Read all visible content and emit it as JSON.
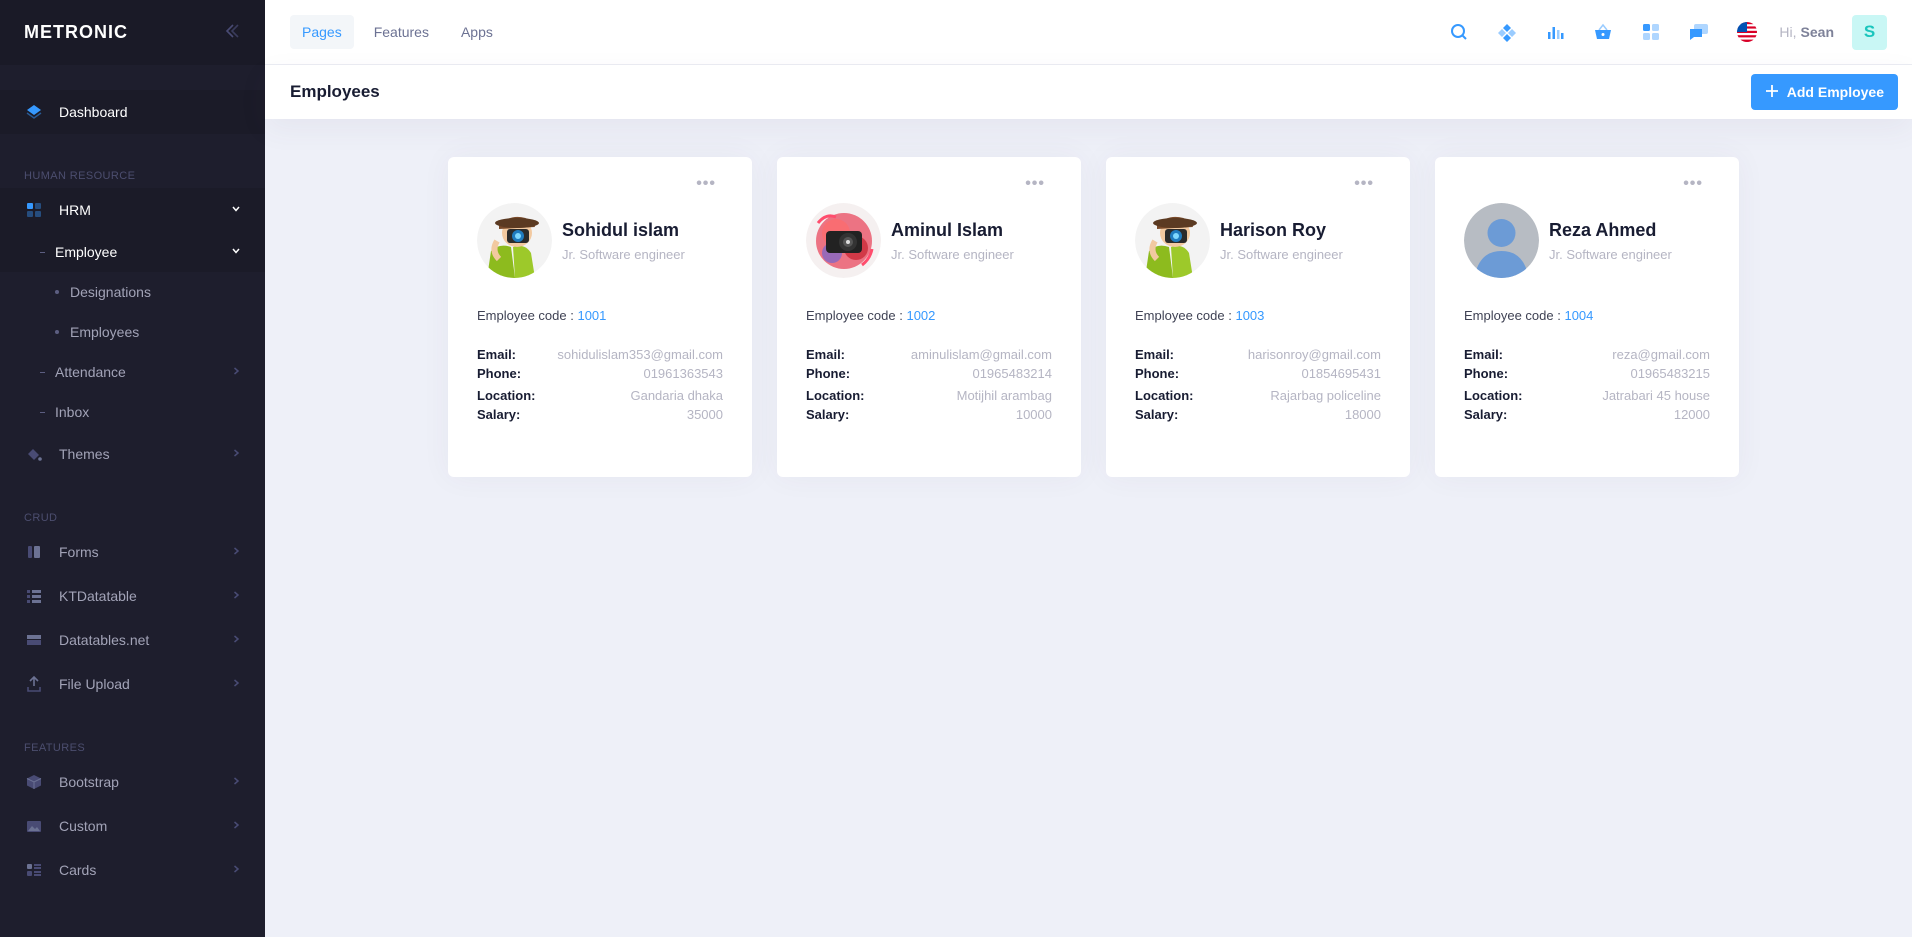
{
  "brand": {
    "name": "METRONIC",
    "toggle_icon": "chevron-double-left-icon"
  },
  "sidebar": {
    "dashboard": "Dashboard",
    "sections": {
      "human_resource": "HUMAN RESOURCE",
      "crud": "CRUD",
      "features": "FEATURES"
    },
    "hrm": "HRM",
    "employee": "Employee",
    "designations": "Designations",
    "employees": "Employees",
    "attendance": "Attendance",
    "inbox": "Inbox",
    "themes": "Themes",
    "forms": "Forms",
    "ktdatatable": "KTDatatable",
    "datatables": "Datatables.net",
    "file_upload": "File Upload",
    "bootstrap": "Bootstrap",
    "custom": "Custom",
    "cards": "Cards"
  },
  "header": {
    "tabs": [
      "Pages",
      "Features",
      "Apps"
    ],
    "active_tab": "Pages",
    "greeting": "Hi,",
    "user_name": "Sean",
    "avatar_letter": "S",
    "icons": [
      "search-icon",
      "layers-icon",
      "chart-icon",
      "basket-icon",
      "apps-icon",
      "chat-icon",
      "us-flag-icon"
    ]
  },
  "subheader": {
    "title": "Employees",
    "add_button": "Add Employee"
  },
  "labels": {
    "employee_code": "Employee code :",
    "email": "Email:",
    "phone": "Phone:",
    "location": "Location:",
    "salary": "Salary:"
  },
  "employees": [
    {
      "name": "Sohidul islam",
      "role": "Jr. Software engineer",
      "code": "1001",
      "email": "sohidulislam353@gmail.com",
      "phone": "01961363543",
      "location": "Gandaria dhaka",
      "salary": "35000",
      "avatar": "photographer-avatar"
    },
    {
      "name": "Aminul Islam",
      "role": "Jr. Software engineer",
      "code": "1002",
      "email": "aminulislam@gmail.com",
      "phone": "01965483214",
      "location": "Motijhil arambag",
      "salary": "10000",
      "avatar": "camera-art-avatar"
    },
    {
      "name": "Harison Roy",
      "role": "Jr. Software engineer",
      "code": "1003",
      "email": "harisonroy@gmail.com",
      "phone": "01854695431",
      "location": "Rajarbag policeline",
      "salary": "18000",
      "avatar": "photographer-avatar"
    },
    {
      "name": "Reza Ahmed",
      "role": "Jr. Software engineer",
      "code": "1004",
      "email": "reza@gmail.com",
      "phone": "01965483215",
      "location": "Jatrabari 45 house",
      "salary": "12000",
      "avatar": "default-person-avatar"
    }
  ],
  "colors": {
    "primary": "#3699ff",
    "sidebar_bg": "#1e1e2d",
    "page_bg": "#eef0f8"
  }
}
